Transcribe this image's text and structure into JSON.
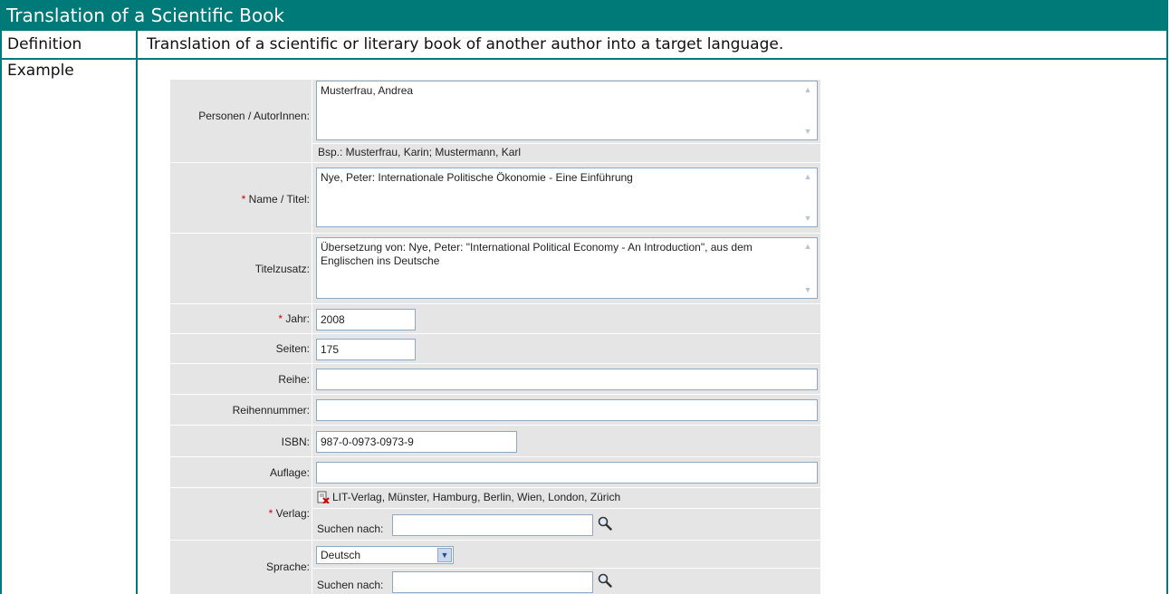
{
  "header": {
    "title": "Translation of a Scientific Book"
  },
  "definition": {
    "label": "Definition",
    "text": "Translation of a scientific or literary book of another author into a target language."
  },
  "example": {
    "label": "Example"
  },
  "form": {
    "personen": {
      "label": "Personen / AutorInnen:",
      "value": "Musterfrau, Andrea",
      "hint": "Bsp.: Musterfrau, Karin; Mustermann, Karl"
    },
    "name": {
      "required": "*",
      "label": " Name / Titel:",
      "value": "Nye, Peter: Internationale Politische Ökonomie - Eine Einführung"
    },
    "titelzusatz": {
      "label": "Titelzusatz:",
      "value": "Übersetzung von: Nye, Peter: \"International Political Economy - An Introduction\", aus dem Englischen ins Deutsche"
    },
    "jahr": {
      "required": "*",
      "label": " Jahr:",
      "value": "2008"
    },
    "seiten": {
      "label": "Seiten:",
      "value": "175"
    },
    "reihe": {
      "label": "Reihe:",
      "value": ""
    },
    "reihennummer": {
      "label": "Reihennummer:",
      "value": ""
    },
    "isbn": {
      "label": "ISBN:",
      "value": "987-0-0973-0973-9"
    },
    "auflage": {
      "label": "Auflage:",
      "value": ""
    },
    "verlag": {
      "required": "*",
      "label": " Verlag:",
      "selected": "LIT-Verlag, Münster, Hamburg, Berlin, Wien, London, Zürich",
      "search_label": "Suchen nach:",
      "search_value": ""
    },
    "sprache": {
      "label": "Sprache:",
      "selected": "Deutsch",
      "search_label": "Suchen nach:",
      "search_value": ""
    }
  },
  "colors": {
    "accent": "#007a78",
    "form_bg": "#e5e5e5",
    "required": "#d40000",
    "input_border": "#8fa9c4"
  }
}
